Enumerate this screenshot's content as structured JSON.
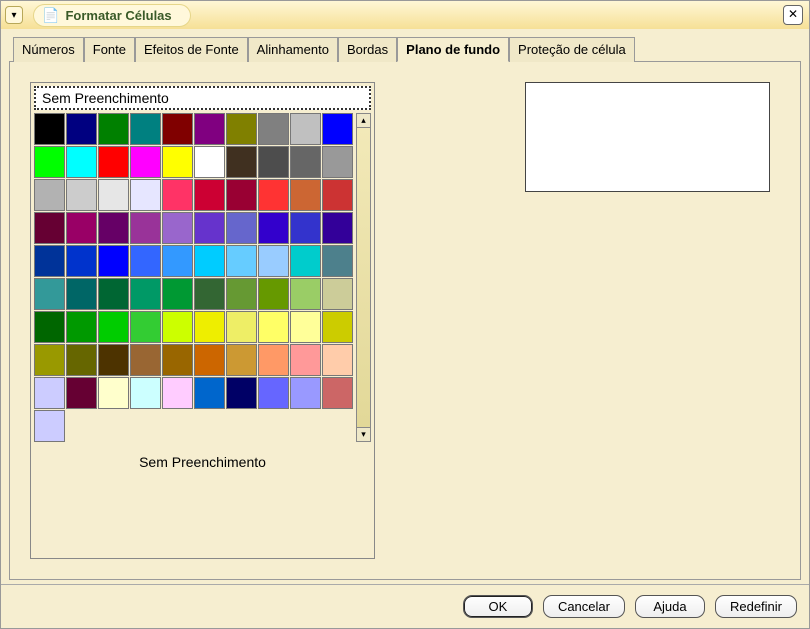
{
  "window": {
    "title": "Formatar Células"
  },
  "tabs": [
    "Números",
    "Fonte",
    "Efeitos de Fonte",
    "Alinhamento",
    "Bordas",
    "Plano de fundo",
    "Proteção de célula"
  ],
  "active_tab_index": 5,
  "background": {
    "selected_name": "Sem Preenchimento",
    "current_label": "Sem Preenchimento",
    "colors": [
      "#000000",
      "#000080",
      "#008000",
      "#008080",
      "#800000",
      "#800080",
      "#808000",
      "#808080",
      "#c0c0c0",
      "#0000ff",
      "#00ff00",
      "#00ffff",
      "#ff0000",
      "#ff00ff",
      "#ffff00",
      "#ffffff",
      "#403020",
      "#4d4d4d",
      "#666666",
      "#999999",
      "#b2b2b2",
      "#cccccc",
      "#e6e6e6",
      "#e6e6ff",
      "#ff3366",
      "#cc0033",
      "#990033",
      "#ff3333",
      "#cc6633",
      "#cc3333",
      "#660033",
      "#990066",
      "#660066",
      "#993399",
      "#9966cc",
      "#6633cc",
      "#6666cc",
      "#3300cc",
      "#3333cc",
      "#330099",
      "#003399",
      "#0033cc",
      "#0000ff",
      "#3366ff",
      "#3399ff",
      "#00ccff",
      "#66ccff",
      "#99ccff",
      "#00cccc",
      "#4d808c",
      "#339999",
      "#006666",
      "#006633",
      "#009966",
      "#009933",
      "#336633",
      "#669933",
      "#669900",
      "#9acd66",
      "#cccc99",
      "#006600",
      "#009900",
      "#00cc00",
      "#33cc33",
      "#ccff00",
      "#eeee00",
      "#eeee66",
      "#ffff66",
      "#ffff99",
      "#cccc00",
      "#999900",
      "#666600",
      "#4d3300",
      "#996633",
      "#996600",
      "#cc6600",
      "#cc9933",
      "#ff9966",
      "#ff9999",
      "#ffccaa",
      "#ccccff",
      "#660033",
      "#ffffcc",
      "#ccffff",
      "#ffccff",
      "#0066cc",
      "#000066",
      "#6666ff",
      "#9999ff",
      "#cc6666",
      "#ccccff"
    ]
  },
  "buttons": {
    "ok": "OK",
    "cancel": "Cancelar",
    "help": "Ajuda",
    "reset": "Redefinir"
  }
}
